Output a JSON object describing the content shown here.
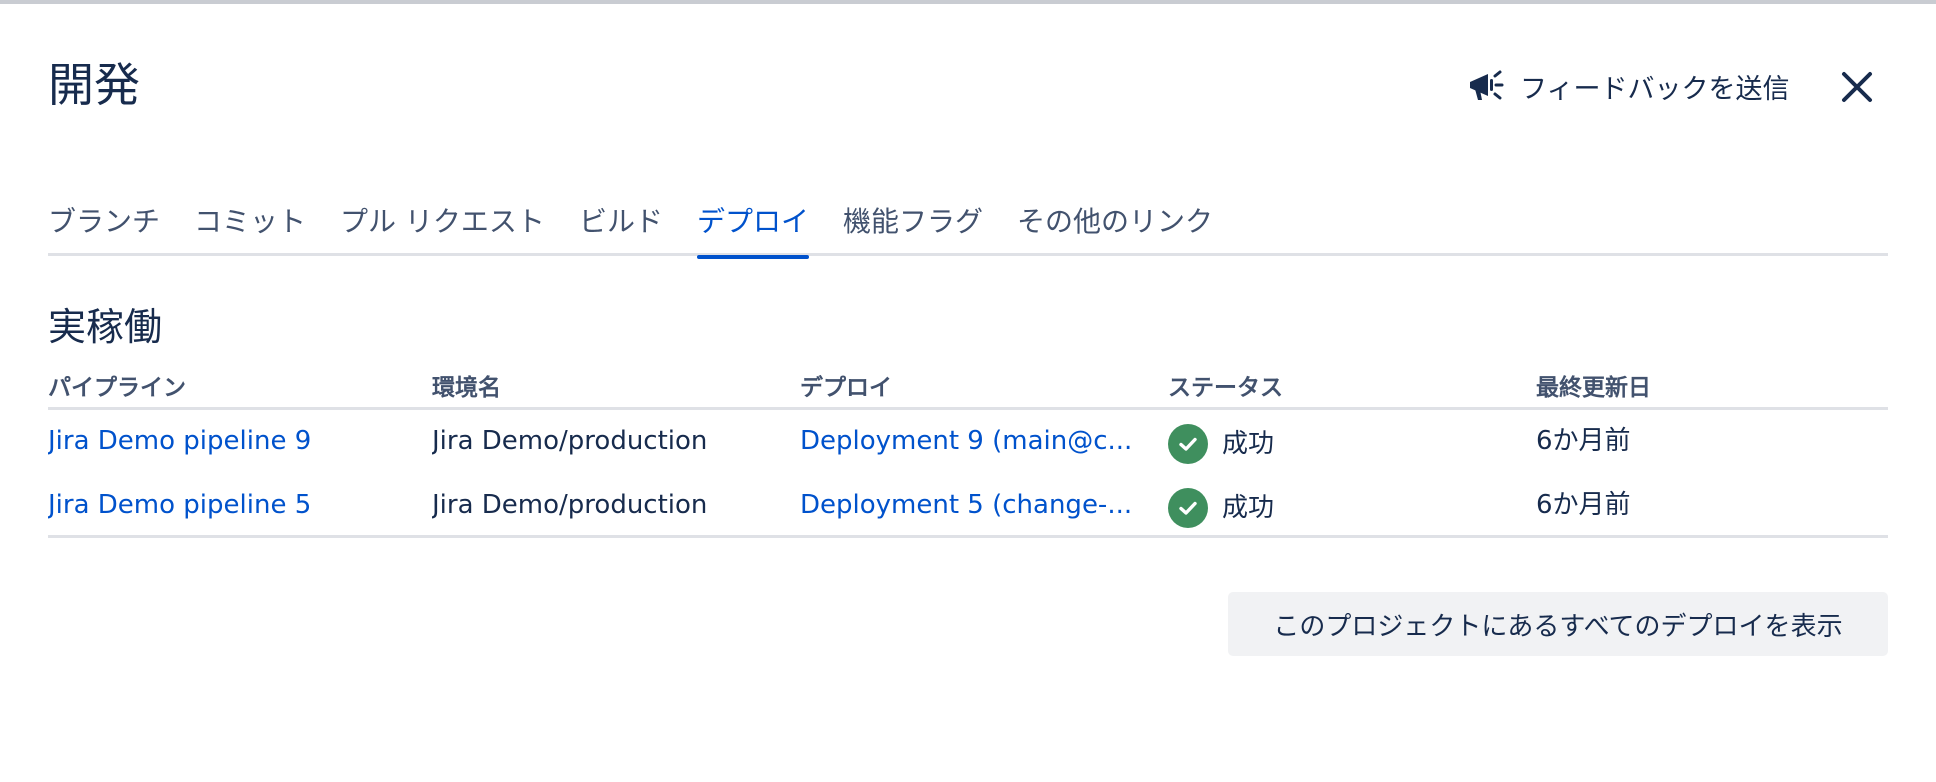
{
  "header": {
    "title": "開発",
    "feedback_label": "フィードバックを送信",
    "feedback_icon": "megaphone-icon",
    "close_icon": "close-icon"
  },
  "tabs": [
    {
      "label": "ブランチ",
      "active": false
    },
    {
      "label": "コミット",
      "active": false
    },
    {
      "label": "プル リクエスト",
      "active": false
    },
    {
      "label": "ビルド",
      "active": false
    },
    {
      "label": "デプロイ",
      "active": true
    },
    {
      "label": "機能フラグ",
      "active": false
    },
    {
      "label": "その他のリンク",
      "active": false
    }
  ],
  "section": {
    "title": "実稼働"
  },
  "table": {
    "headers": [
      "パイプライン",
      "環境名",
      "デプロイ",
      "ステータス",
      "最終更新日"
    ],
    "rows": [
      {
        "pipeline": "Jira Demo pipeline 9",
        "environment": "Jira Demo/production",
        "deployment": "Deployment 9 (main@c...",
        "status": "成功",
        "updated": "6か月前"
      },
      {
        "pipeline": "Jira Demo pipeline 5",
        "environment": "Jira Demo/production",
        "deployment": "Deployment 5 (change-...",
        "status": "成功",
        "updated": "6か月前"
      }
    ]
  },
  "footer": {
    "view_all_label": "このプロジェクトにあるすべてのデプロイを表示"
  },
  "colors": {
    "accent": "#0052cc",
    "success": "#3f8f5e",
    "text": "#172b4d",
    "subtle": "#42526e",
    "divider": "#dfe1e6",
    "button_bg": "#f1f2f4"
  }
}
